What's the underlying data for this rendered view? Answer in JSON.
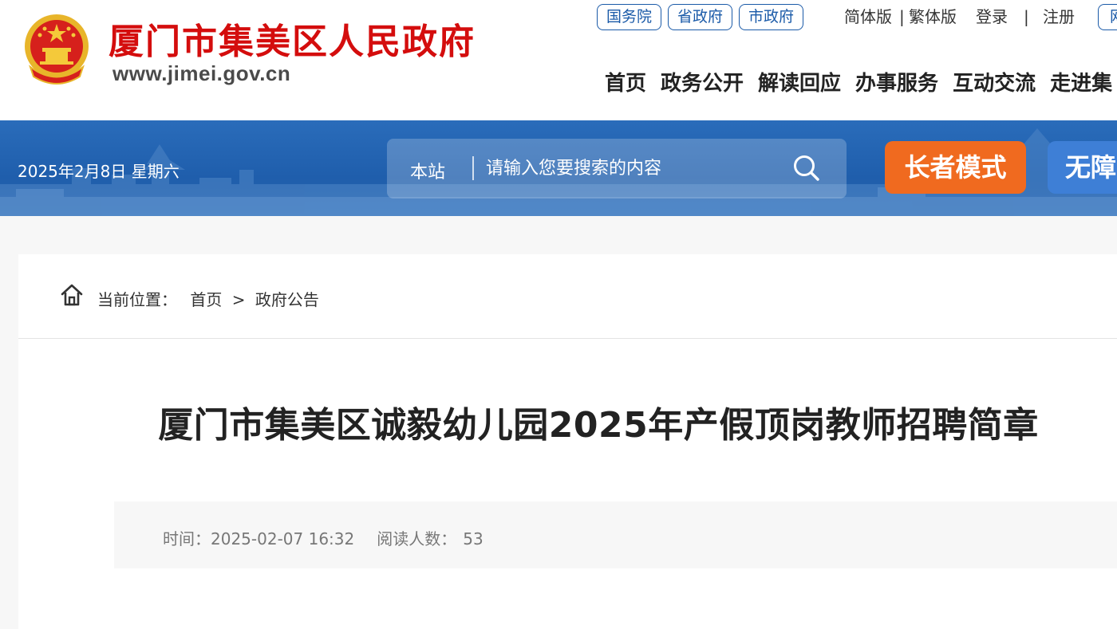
{
  "header": {
    "site_title": "厦门市集美区人民政府",
    "site_url": "www.jimei.gov.cn",
    "emblem_icon": "national-emblem-icon",
    "gov_links": [
      "国务院",
      "省政府",
      "市政府"
    ],
    "simplified_label": "简体版",
    "lang_separator": "|",
    "traditional_label": "繁体版",
    "login_label": "登录",
    "auth_separator": "|",
    "register_label": "注册",
    "partial_link": "网",
    "nav": [
      "首页",
      "政务公开",
      "解读回应",
      "办事服务",
      "互动交流",
      "走进集"
    ]
  },
  "banner": {
    "date": "2025年2月8日 星期六",
    "search_scope": "本站",
    "search_placeholder": "请输入您要搜索的内容",
    "elder_mode": "长者模式",
    "accessibility": "无障",
    "colors": {
      "banner": "#1f5eac",
      "elder": "#f06a1f",
      "accessibility": "#3e7fd6"
    }
  },
  "breadcrumb": {
    "label": "当前位置：",
    "items": [
      "首页",
      "政府公告"
    ],
    "separator": ">"
  },
  "article": {
    "title": "厦门市集美区诚毅幼儿园2025年产假顶岗教师招聘简章",
    "time_label": "时间：",
    "time_value": "2025-02-07 16:32",
    "reads_label": "阅读人数：",
    "reads_value": "53"
  },
  "colors": {
    "brand_red": "#d40d0d",
    "link_blue": "#1a5aa8"
  }
}
